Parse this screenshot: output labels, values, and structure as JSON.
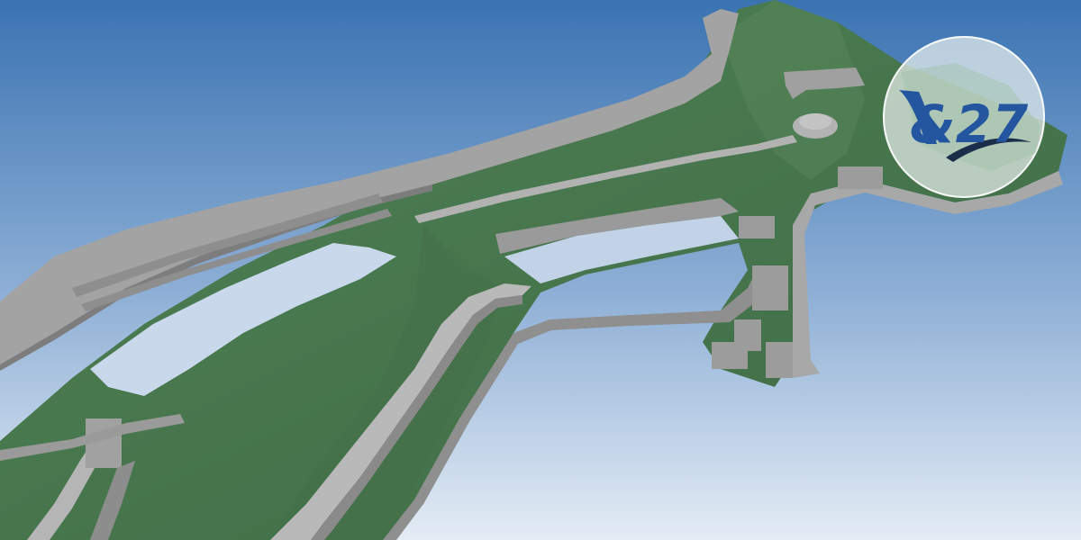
{
  "scene": {
    "description_kind": "3d-terrain-render",
    "colors": {
      "sky_top": "#3a73b2",
      "sky_bottom": "#dfe8f3",
      "terrain": "#4c7a50",
      "terrain_dark": "#3f6a44",
      "structure": "#a6a6a6",
      "structure_dark": "#7d7d7d",
      "logo_blue": "#2456a0",
      "logo_dark": "#1a2e4a"
    }
  },
  "logo": {
    "text": "&27",
    "icon": "wing-logo-icon"
  }
}
